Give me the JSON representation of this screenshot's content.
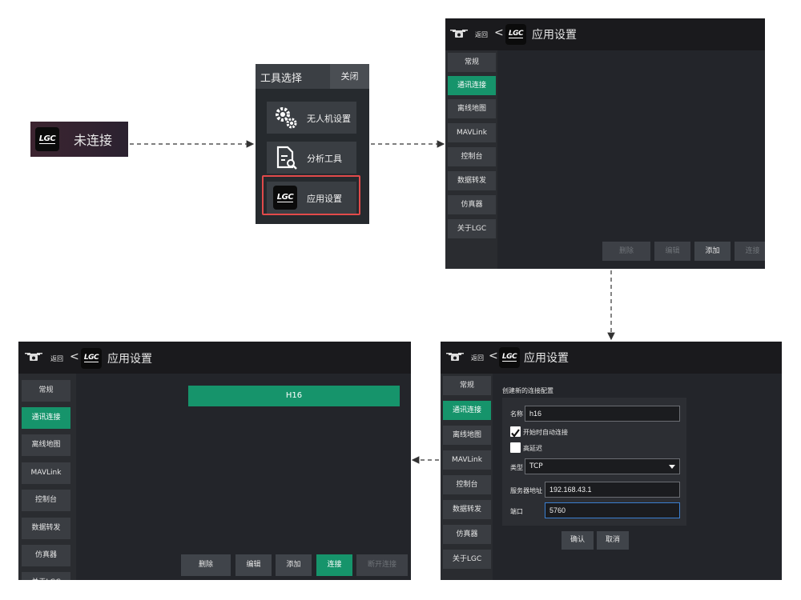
{
  "status_chip": {
    "logo_text": "LGC",
    "status": "未连接"
  },
  "tool_dialog": {
    "title": "工具选择",
    "close_label": "关闭",
    "items": [
      {
        "label": "无人机设置",
        "icon": "gears-icon"
      },
      {
        "label": "分析工具",
        "icon": "document-search-icon"
      },
      {
        "label": "应用设置",
        "icon": "lgc-logo-icon"
      }
    ]
  },
  "header": {
    "back_label": "返回",
    "back_arrow": "<",
    "logo_text": "LGC",
    "title": "应用设置"
  },
  "sidebar": {
    "items": [
      "常规",
      "通讯连接",
      "离线地图",
      "MAVLink",
      "控制台",
      "数据转发",
      "仿真器",
      "关于LGC"
    ],
    "active_index": 1
  },
  "panel_top_actions": [
    "删除",
    "编辑",
    "添加",
    "连接"
  ],
  "panel_bottom_left": {
    "link_item": "H16",
    "actions": [
      "删除",
      "编辑",
      "添加",
      "连接",
      "断开连接"
    ]
  },
  "connection_form": {
    "heading": "创建新的连接配置",
    "name_label": "名称",
    "name_value": "h16",
    "auto_connect_label": "开始时自动连接",
    "auto_connect_checked": true,
    "high_latency_label": "高延迟",
    "high_latency_checked": false,
    "type_label": "类型",
    "type_value": "TCP",
    "server_label": "服务器地址",
    "server_value": "192.168.43.1",
    "port_label": "端口",
    "port_value": "5760",
    "ok_label": "确认",
    "cancel_label": "取消"
  },
  "colors": {
    "accent_green": "#16946b",
    "highlight_red": "#e24a4a",
    "panel_bg": "#1c1d21"
  }
}
